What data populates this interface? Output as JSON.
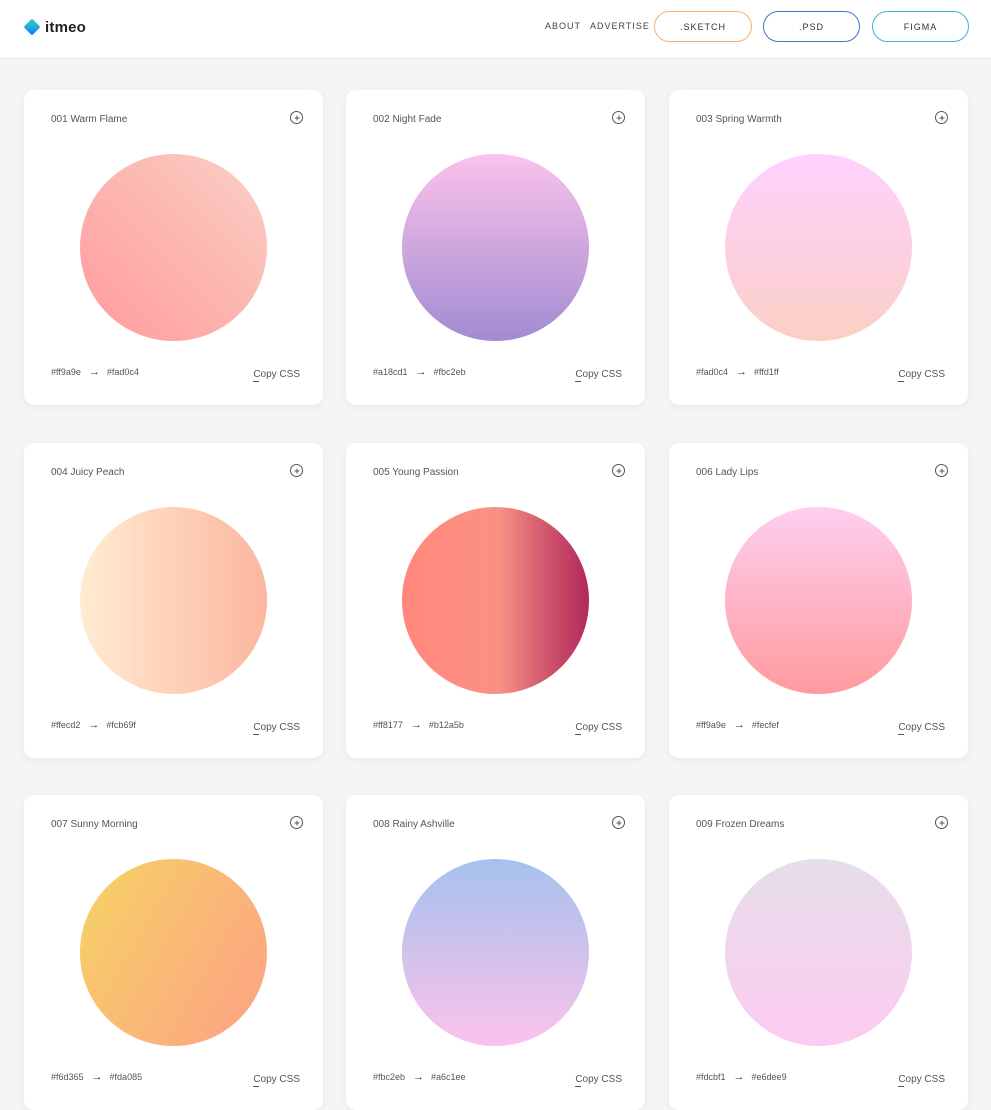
{
  "header": {
    "logo_text": "itmeo",
    "nav": [
      {
        "label": "ABOUT"
      },
      {
        "label": "ADVERTISE"
      }
    ],
    "buttons": [
      {
        "label": ".SKETCH",
        "color": "#f5b06a"
      },
      {
        "label": ".PSD",
        "color": "#3a78c4"
      },
      {
        "label": "FIGMA",
        "color": "#3fb1d6"
      }
    ]
  },
  "copy_label": "Copy CSS",
  "arrow_glyph": "→",
  "gradients": [
    {
      "title": "001 Warm Flame",
      "from": "#ff9a9e",
      "to": "#fad0c4",
      "angle": "45deg"
    },
    {
      "title": "002 Night Fade",
      "from": "#a18cd1",
      "to": "#fbc2eb",
      "angle": "0deg"
    },
    {
      "title": "003 Spring Warmth",
      "from": "#fad0c4",
      "to": "#ffd1ff",
      "angle": "0deg"
    },
    {
      "title": "004 Juicy Peach",
      "from": "#ffecd2",
      "to": "#fcb69f",
      "angle": "90deg"
    },
    {
      "title": "005 Young Passion",
      "from": "#ff8177",
      "to": "#b12a5b",
      "angle": "90deg",
      "stops": "#ff8177 0%, #ff867a 0%, #ff8c7f 21%, #f99185 52%, #cf556c 78%, #b12a5b 100%"
    },
    {
      "title": "006 Lady Lips",
      "from": "#ff9a9e",
      "to": "#fecfef",
      "angle": "0deg"
    },
    {
      "title": "007 Sunny Morning",
      "from": "#f6d365",
      "to": "#fda085",
      "angle": "120deg"
    },
    {
      "title": "008 Rainy Ashville",
      "from": "#fbc2eb",
      "to": "#a6c1ee",
      "angle": "0deg"
    },
    {
      "title": "009 Frozen Dreams",
      "from": "#fdcbf1",
      "to": "#e6dee9",
      "angle": "0deg"
    }
  ]
}
